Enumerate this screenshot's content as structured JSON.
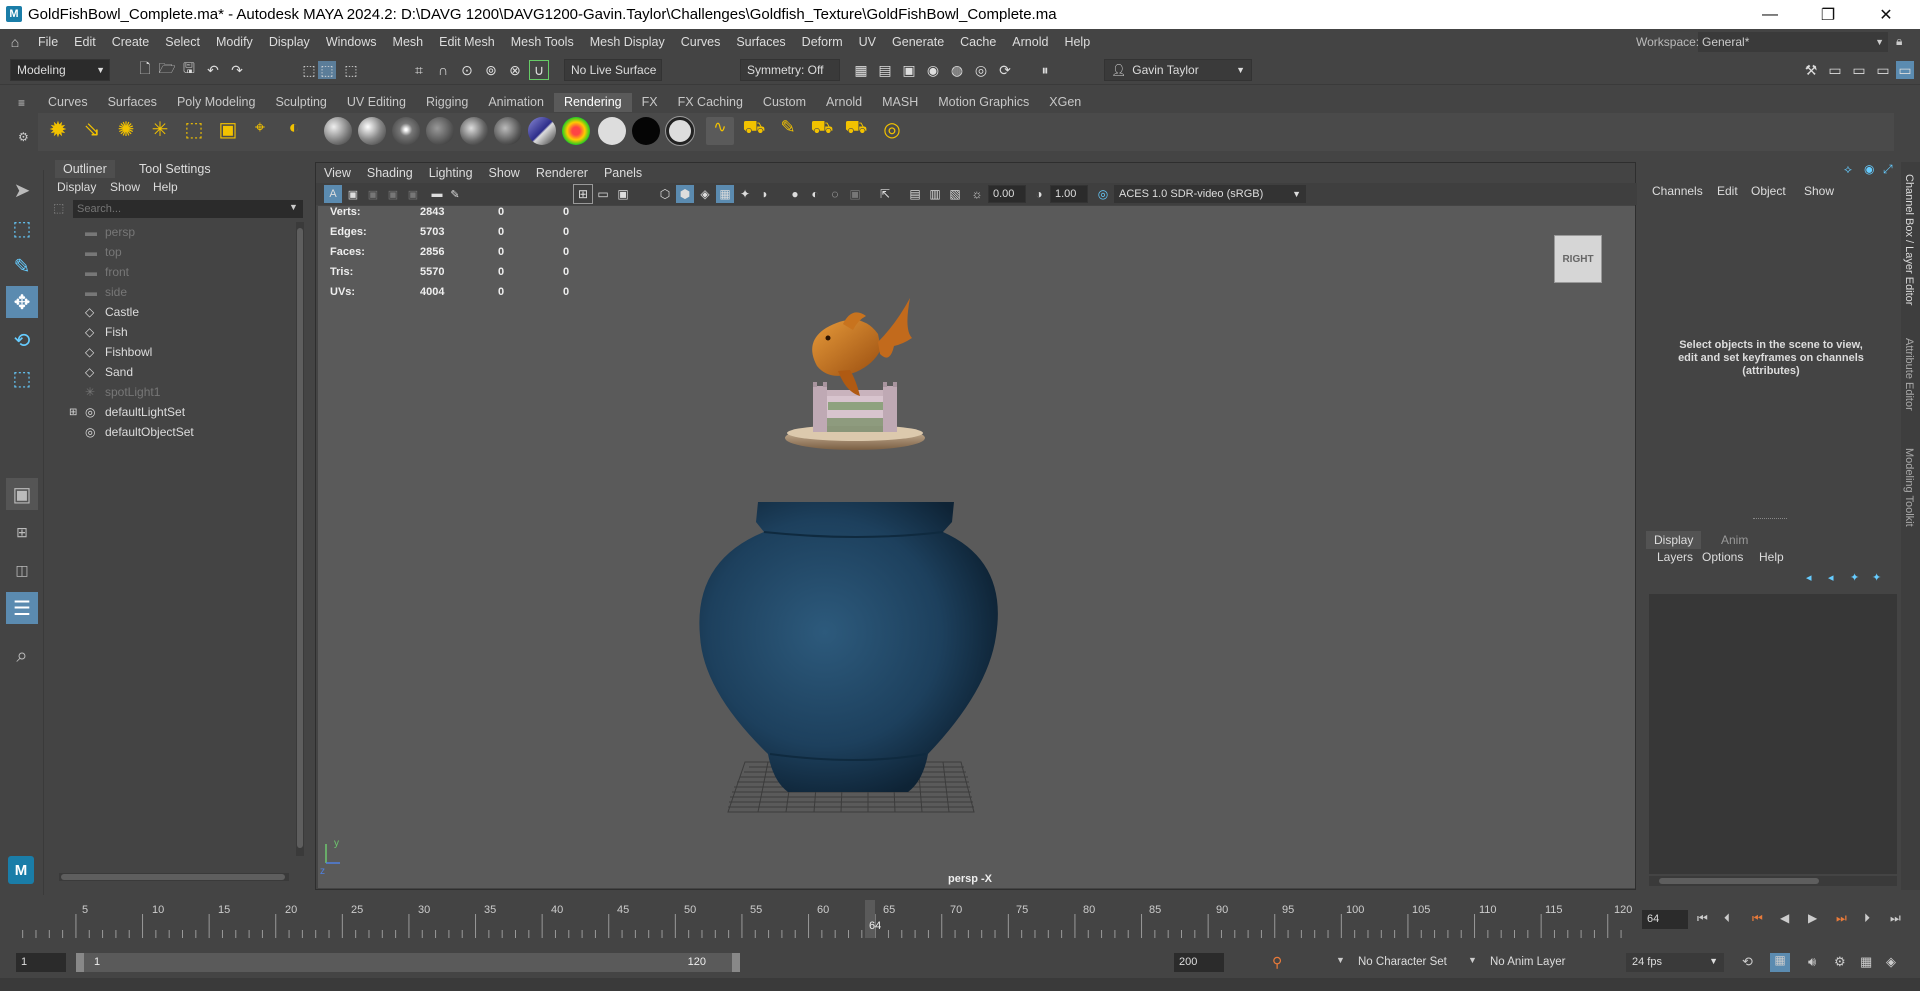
{
  "window": {
    "title": "GoldFishBowl_Complete.ma* - Autodesk MAYA 2024.2: D:\\DAVG 1200\\DAVG1200-Gavin.Taylor\\Challenges\\Goldfish_Texture\\GoldFishBowl_Complete.ma",
    "minimize": "—",
    "restore": "❐",
    "close": "✕"
  },
  "menubar": {
    "items": [
      "File",
      "Edit",
      "Create",
      "Select",
      "Modify",
      "Display",
      "Windows",
      "Mesh",
      "Edit Mesh",
      "Mesh Tools",
      "Mesh Display",
      "Curves",
      "Surfaces",
      "Deform",
      "UV",
      "Generate",
      "Cache",
      "Arnold",
      "Help"
    ],
    "workspace_label": "Workspace:",
    "workspace_value": "General*"
  },
  "statusline": {
    "menuset": "Modeling",
    "live_surface": "No Live Surface",
    "symmetry": "Symmetry: Off",
    "user": "Gavin Taylor"
  },
  "shelf": {
    "tabs": [
      "Curves",
      "Surfaces",
      "Poly Modeling",
      "Sculpting",
      "UV Editing",
      "Rigging",
      "Animation",
      "Rendering",
      "FX",
      "FX Caching",
      "Custom",
      "Arnold",
      "MASH",
      "Motion Graphics",
      "XGen"
    ],
    "active_tab": "Rendering"
  },
  "outliner": {
    "tabs": [
      "Outliner",
      "Tool Settings"
    ],
    "menu": [
      "Display",
      "Show",
      "Help"
    ],
    "search_placeholder": "Search...",
    "items": [
      {
        "label": "persp",
        "icon": "camera-icon",
        "dim": true
      },
      {
        "label": "top",
        "icon": "camera-icon",
        "dim": true
      },
      {
        "label": "front",
        "icon": "camera-icon",
        "dim": true
      },
      {
        "label": "side",
        "icon": "camera-icon",
        "dim": true
      },
      {
        "label": "Castle",
        "icon": "transform-icon",
        "dim": false
      },
      {
        "label": "Fish",
        "icon": "transform-icon",
        "dim": false
      },
      {
        "label": "Fishbowl",
        "icon": "transform-icon",
        "dim": false
      },
      {
        "label": "Sand",
        "icon": "transform-icon",
        "dim": false
      },
      {
        "label": "spotLight1",
        "icon": "spotlight-icon",
        "dim": true
      },
      {
        "label": "defaultLightSet",
        "icon": "set-icon",
        "dim": false,
        "expandable": true
      },
      {
        "label": "defaultObjectSet",
        "icon": "set-icon",
        "dim": false
      }
    ]
  },
  "viewport": {
    "menu": [
      "View",
      "Shading",
      "Lighting",
      "Show",
      "Renderer",
      "Panels"
    ],
    "exposure": "0.00",
    "gamma": "1.00",
    "color_transform": "ACES 1.0 SDR-video (sRGB)",
    "stats": [
      {
        "label": "Verts:",
        "v1": "2843",
        "v2": "0",
        "v3": "0"
      },
      {
        "label": "Edges:",
        "v1": "5703",
        "v2": "0",
        "v3": "0"
      },
      {
        "label": "Faces:",
        "v1": "2856",
        "v2": "0",
        "v3": "0"
      },
      {
        "label": "Tris:",
        "v1": "5570",
        "v2": "0",
        "v3": "0"
      },
      {
        "label": "UVs:",
        "v1": "4004",
        "v2": "0",
        "v3": "0"
      }
    ],
    "viewcube_label": "RIGHT",
    "camera_label": "persp -X",
    "axis_y": "y",
    "axis_z": "z"
  },
  "channelbox": {
    "menu": [
      "Channels",
      "Edit",
      "Object",
      "Show"
    ],
    "message": "Select objects in the scene to view, edit and set keyframes on channels (attributes)",
    "layer_tabs": [
      "Display",
      "Anim"
    ],
    "layer_menu": [
      "Layers",
      "Options",
      "Help"
    ]
  },
  "sidetabs": [
    "Channel Box / Layer Editor",
    "Attribute Editor",
    "Modeling Toolkit"
  ],
  "timeline": {
    "ticks": [
      "5",
      "10",
      "15",
      "20",
      "25",
      "30",
      "35",
      "40",
      "45",
      "50",
      "55",
      "60",
      "65",
      "70",
      "75",
      "80",
      "85",
      "90",
      "95",
      "100",
      "105",
      "110",
      "115",
      "120"
    ],
    "current_frame": "64",
    "current_frame_field": "64"
  },
  "range": {
    "start": "1",
    "inner_start": "1",
    "inner_end": "120",
    "end": "200",
    "character_set": "No Character Set",
    "anim_layer": "No Anim Layer",
    "fps": "24 fps"
  }
}
